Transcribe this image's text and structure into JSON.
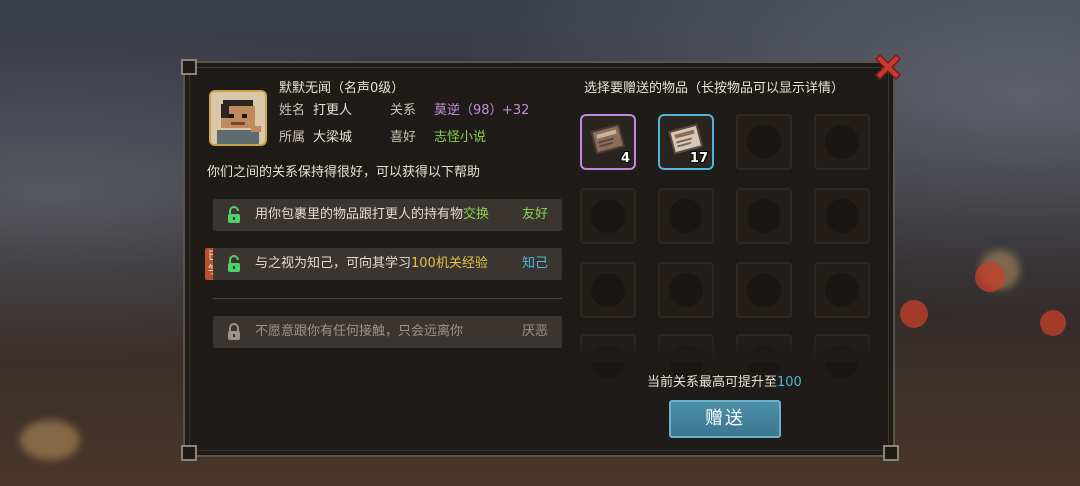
{
  "npc": {
    "header": "默默无闻（名声0级）",
    "name_label": "姓名",
    "name_value": "打更人",
    "relation_label": "关系",
    "relation_value": "莫逆（98）",
    "relation_delta": "+32",
    "faction_label": "所属",
    "faction_value": "大梁城",
    "hobby_label": "喜好",
    "hobby_value": "志怪小说",
    "help_intro": "你们之间的关系保持得很好，可以获得以下帮助"
  },
  "benefits": [
    {
      "text_pre": "用你包裹里的物品跟打更人的持有物",
      "text_hl": "交换",
      "tag": "友好",
      "tag_color": "#8fd14f",
      "hl_color": "#8fd14f",
      "icon": "unlocked-lock-icon"
    },
    {
      "text_pre": "与之视为知己，可向其学习",
      "text_hl": "100机关经验",
      "tag": "知己",
      "tag_color": "#4fb6d9",
      "hl_color": "#8fd14f",
      "hl_num_color": "#e3c14b",
      "badge": "已学",
      "icon": "unlocked-lock-icon"
    },
    {
      "text_pre": "不愿意跟你有任何接触，只会远离你",
      "text_hl": "",
      "tag": "厌恶",
      "tag_color": "#9a948a",
      "icon": "locked-lock-icon"
    }
  ],
  "gift": {
    "title": "选择要赠送的物品（长按物品可以显示详情）",
    "items": [
      {
        "name": "book-item",
        "count": "4",
        "frame_color": "#c58ae0"
      },
      {
        "name": "book-item",
        "count": "17",
        "frame_color": "#4fb6d9"
      }
    ],
    "limit_prefix": "当前关系最高可提升至",
    "limit_value": "100",
    "button_label": "赠送"
  },
  "colors": {
    "accent_purple": "#c58ae0",
    "accent_green": "#8fd14f",
    "accent_blue": "#4fb6d9",
    "close_red": "#c83a2e"
  }
}
